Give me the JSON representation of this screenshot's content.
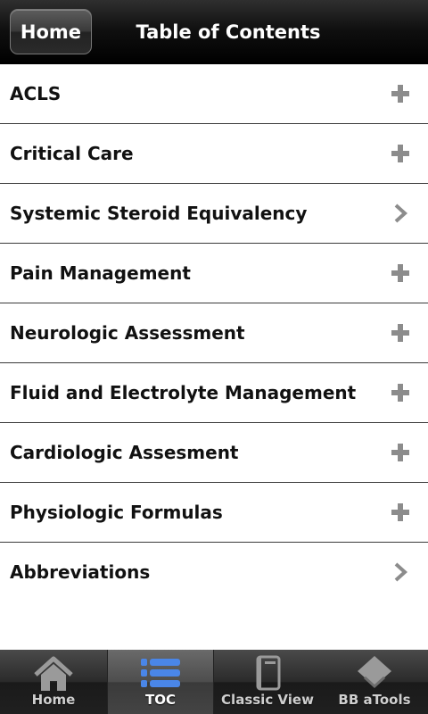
{
  "header": {
    "home_button": "Home",
    "title": "Table of Contents"
  },
  "toc": {
    "items": [
      {
        "label": "ACLS",
        "icon": "plus-icon"
      },
      {
        "label": "Critical Care",
        "icon": "plus-icon"
      },
      {
        "label": "Systemic Steroid Equivalency",
        "icon": "chevron-right-icon"
      },
      {
        "label": "Pain Management",
        "icon": "plus-icon"
      },
      {
        "label": "Neurologic Assessment",
        "icon": "plus-icon"
      },
      {
        "label": "Fluid and Electrolyte Management",
        "icon": "plus-icon"
      },
      {
        "label": "Cardiologic Assesment",
        "icon": "plus-icon"
      },
      {
        "label": "Physiologic Formulas",
        "icon": "plus-icon"
      },
      {
        "label": "Abbreviations",
        "icon": "chevron-right-icon"
      }
    ]
  },
  "tabbar": {
    "tabs": [
      {
        "label": "Home",
        "icon": "house-icon",
        "active": false
      },
      {
        "label": "TOC",
        "icon": "list-icon",
        "active": true
      },
      {
        "label": "Classic View",
        "icon": "book-icon",
        "active": false
      },
      {
        "label": "BB aTools",
        "icon": "tools-icon",
        "active": false
      }
    ]
  },
  "colors": {
    "header_bg": "#000000",
    "list_bg": "#ffffff",
    "row_text": "#111111",
    "icon_gray": "#8c8c8c",
    "active_tab_icon": "#4a86e8"
  }
}
